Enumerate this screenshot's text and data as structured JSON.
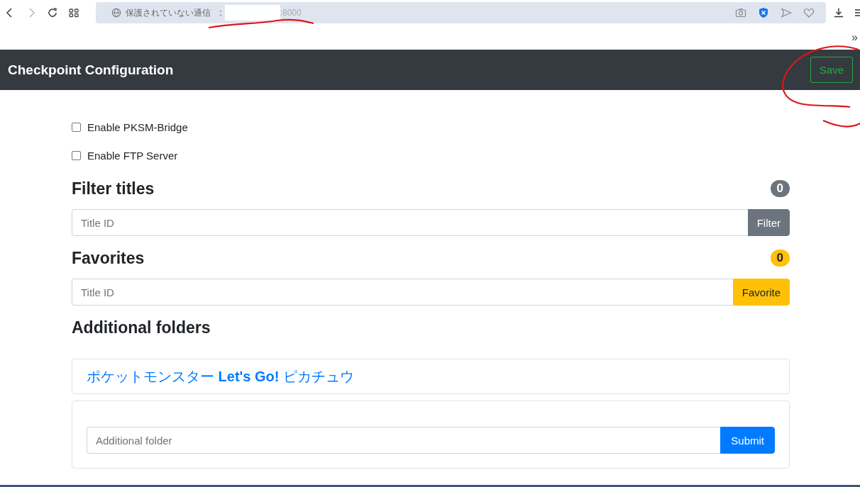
{
  "browser": {
    "security_label": "保護されていない通信",
    "url_prefix": ":",
    "url_port": ":8000",
    "bookmarks_overflow": "»"
  },
  "header": {
    "title": "Checkpoint Configuration",
    "save_button": "Save"
  },
  "options": [
    {
      "label": "Enable PKSM-Bridge",
      "checked": false
    },
    {
      "label": "Enable FTP Server",
      "checked": false
    }
  ],
  "sections": [
    {
      "kind": "filter",
      "title": "Filter titles",
      "count": "0",
      "color": "#6c757d",
      "placeholder": "Title ID",
      "button": "Filter"
    },
    {
      "kind": "favorite",
      "title": "Favorites",
      "count": "0",
      "color": "#ffc107",
      "placeholder": "Title ID",
      "button": "Favorite"
    }
  ],
  "folders": {
    "title": "Additional folders",
    "items": [
      {
        "label": "ポケットモンスター **Let's Go!** ピカチュウ"
      }
    ],
    "placeholder": "Additional folder",
    "button": "Submit"
  }
}
